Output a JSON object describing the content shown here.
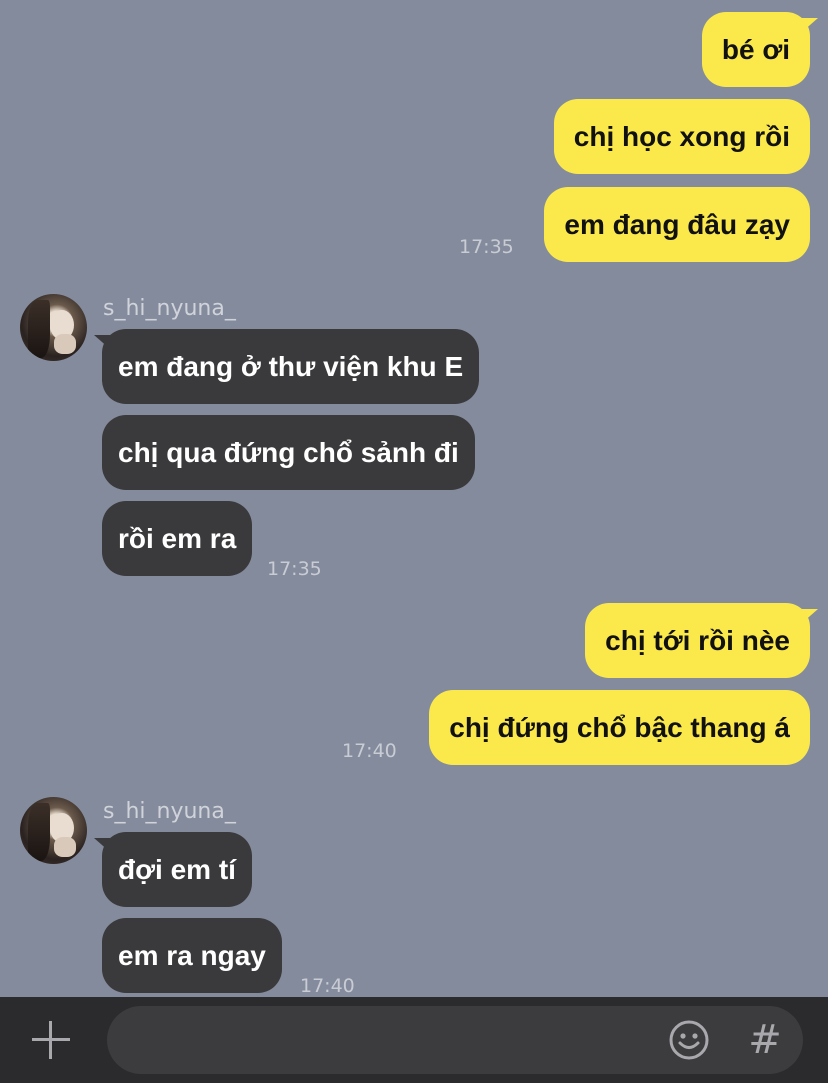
{
  "messages": {
    "m1": "bé ơi",
    "m2": "chị học xong rồi",
    "m3": "em đang đâu zạy",
    "t1": "17:35",
    "sender1": "s_hi_nyuna_",
    "m4": "em đang ở thư viện khu E",
    "m5": "chị qua đứng chổ sảnh đi",
    "m6": "rồi em ra",
    "t2": "17:35",
    "m7": "chị tới rồi nèe",
    "m8": "chị đứng chổ bậc thang á",
    "t3": "17:40",
    "sender2": "s_hi_nyuna_",
    "m9": "đợi em tí",
    "m10": "em ra ngay",
    "t4": "17:40"
  },
  "composer": {
    "input_value": "",
    "placeholder": "",
    "hash_glyph": "#"
  },
  "icons": {
    "add": "plus-icon",
    "emoji": "emoji-icon",
    "hashtag": "hashtag-icon"
  },
  "colors": {
    "background": "#848b9c",
    "outgoing_bubble": "#fbe94c",
    "incoming_bubble": "#3a3a3c",
    "bottom_bar": "#2b2b2d"
  }
}
